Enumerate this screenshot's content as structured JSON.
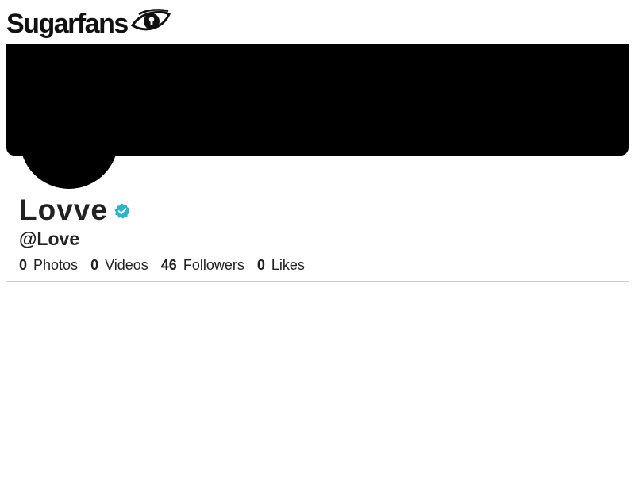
{
  "header": {
    "logo_text": "Sugarfans",
    "logo_icon": "eye-keyhole-icon"
  },
  "profile": {
    "display_name": "Lovve",
    "username": "@Love",
    "verified": true,
    "verified_color": "#2bb5c8",
    "cover_color": "#000000",
    "avatar_color": "#000000"
  },
  "stats": [
    {
      "count": "0",
      "label": "Photos"
    },
    {
      "count": "0",
      "label": "Videos"
    },
    {
      "count": "46",
      "label": "Followers"
    },
    {
      "count": "0",
      "label": "Likes"
    }
  ]
}
